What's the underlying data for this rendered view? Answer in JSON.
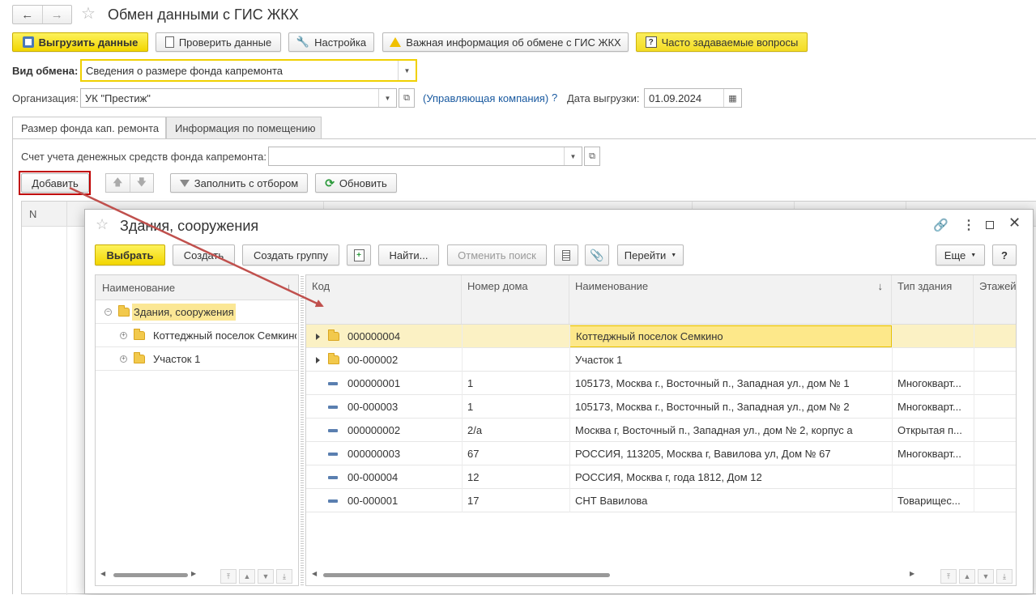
{
  "window": {
    "title": "Обмен данными с ГИС ЖКХ"
  },
  "toolbar": {
    "upload": "Выгрузить данные",
    "check": "Проверить данные",
    "settings": "Настройка",
    "important": "Важная информация об обмене с ГИС ЖКХ",
    "faq": "Часто задаваемые вопросы"
  },
  "form": {
    "exchange_type_label": "Вид обмена:",
    "exchange_type_value": "Сведения о размере фонда капремонта",
    "org_label": "Организация:",
    "org_value": "УК \"Престиж\"",
    "org_role_link": "(Управляющая компания)",
    "help_q": "?",
    "date_label": "Дата выгрузки:",
    "date_value": "01.09.2024"
  },
  "tabs": [
    {
      "label": "Размер фонда кап. ремонта"
    },
    {
      "label": "Информация по помещению"
    }
  ],
  "tab_content": {
    "account_label": "Счет учета денежных средств фонда капремонта:",
    "account_value": "",
    "add": "Добавить",
    "fill_filter": "Заполнить с отбором",
    "refresh": "Обновить",
    "col_n": "N"
  },
  "dialog": {
    "title": "Здания, сооружения",
    "choose": "Выбрать",
    "create": "Создать",
    "create_group": "Создать группу",
    "find": "Найти...",
    "cancel_search": "Отменить поиск",
    "goto": "Перейти",
    "more": "Еще",
    "help": "?",
    "tree": {
      "header": "Наименование",
      "sort": "↓",
      "root": "Здания, сооружения",
      "children": [
        "Коттеджный поселок Семкино",
        "Участок 1"
      ]
    },
    "list": {
      "headers": {
        "code": "Код",
        "house": "Номер дома",
        "name": "Наименование",
        "sort": "↓",
        "type": "Тип здания",
        "floors": "Этажей"
      },
      "rows": [
        {
          "kind": "group",
          "code": "000000004",
          "house": "",
          "name": "Коттеджный поселок Семкино",
          "type": "",
          "selected": true
        },
        {
          "kind": "group",
          "code": "00-000002",
          "house": "",
          "name": "Участок 1",
          "type": ""
        },
        {
          "kind": "item",
          "code": "000000001",
          "house": "1",
          "name": "105173, Москва г., Восточный п., Западная ул., дом № 1",
          "type": "Многокварт..."
        },
        {
          "kind": "item",
          "code": "00-000003",
          "house": "1",
          "name": "105173, Москва г., Восточный п., Западная ул., дом № 2",
          "type": "Многокварт..."
        },
        {
          "kind": "item",
          "code": "000000002",
          "house": "2/а",
          "name": "Москва г, Восточный п., Западная ул., дом № 2, корпус а",
          "type": "Открытая п..."
        },
        {
          "kind": "item",
          "code": "000000003",
          "house": "67",
          "name": "РОССИЯ, 113205, Москва г, Вавилова ул, Дом № 67",
          "type": "Многокварт..."
        },
        {
          "kind": "item",
          "code": "00-000004",
          "house": "12",
          "name": "РОССИЯ, Москва г, года 1812, Дом 12",
          "type": ""
        },
        {
          "kind": "item",
          "code": "00-000001",
          "house": "17",
          "name": "СНТ Вавилова",
          "type": "Товарищес..."
        }
      ]
    }
  },
  "colors": {
    "accent_yellow": "#f5de1c",
    "arrow": "#c0504d",
    "highlight_border": "#c00000",
    "link": "#1a5aa0"
  }
}
